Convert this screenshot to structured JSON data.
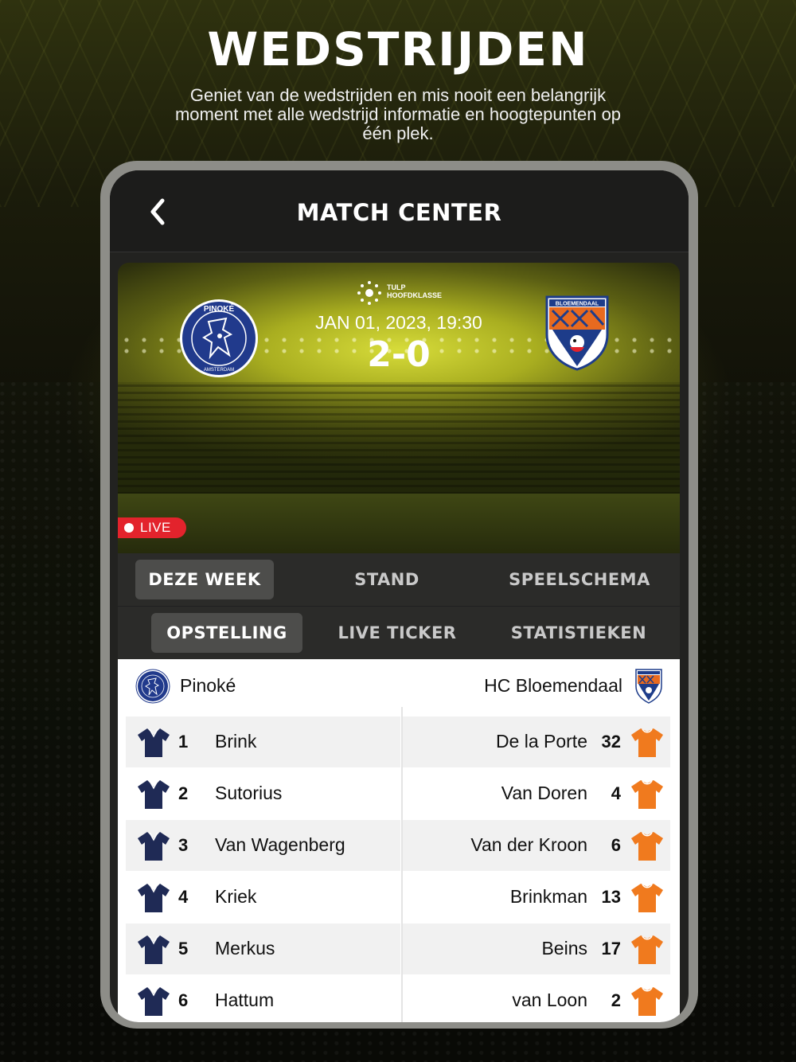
{
  "promo": {
    "headline": "WEDSTRIJDEN",
    "description": "Geniet van de wedstrijden en mis nooit een belangrijk moment met alle wedstrijd informatie en hoogtepunten op één plek."
  },
  "header": {
    "title": "MATCH CENTER"
  },
  "match": {
    "league_line1": "TULP",
    "league_line2": "HOOFDKLASSE",
    "date": "JAN 01, 2023, 19:30",
    "score": "2-0",
    "home_logo_text": "PINOKÉ",
    "home_logo_sub": "AMSTERDAM",
    "away_logo_text": "BLOEMENDAAL",
    "live_label": "LIVE"
  },
  "tabs_main": [
    {
      "label": "DEZE WEEK",
      "active": true
    },
    {
      "label": "STAND",
      "active": false
    },
    {
      "label": "SPEELSCHEMA",
      "active": false
    }
  ],
  "tabs_sub": [
    {
      "label": "OPSTELLING",
      "active": true
    },
    {
      "label": "LIVE TICKER",
      "active": false
    },
    {
      "label": "STATISTIEKEN",
      "active": false
    }
  ],
  "lineup": {
    "home_team": "Pinoké",
    "away_team": "HC Bloemendaal",
    "home_players": [
      {
        "number": "1",
        "name": "Brink"
      },
      {
        "number": "2",
        "name": "Sutorius"
      },
      {
        "number": "3",
        "name": "Van Wagenberg"
      },
      {
        "number": "4",
        "name": "Kriek"
      },
      {
        "number": "5",
        "name": "Merkus"
      },
      {
        "number": "6",
        "name": "Hattum"
      }
    ],
    "away_players": [
      {
        "number": "32",
        "name": "De la Porte"
      },
      {
        "number": "4",
        "name": "Van Doren"
      },
      {
        "number": "6",
        "name": "Van der Kroon"
      },
      {
        "number": "13",
        "name": "Brinkman"
      },
      {
        "number": "17",
        "name": "Beins"
      },
      {
        "number": "2",
        "name": "van Loon"
      }
    ]
  },
  "colors": {
    "accent_yellow": "#d7dc3a",
    "live_red": "#e3232c",
    "home_shirt": "#1f2a55",
    "away_shirt": "#f07a1e"
  }
}
